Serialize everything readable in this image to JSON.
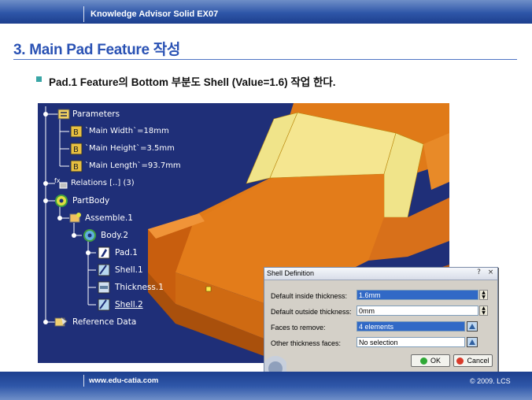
{
  "header": {
    "title": "Knowledge Advisor Solid EX07"
  },
  "slide": {
    "title": "3. Main Pad Feature 작성",
    "bullet": "Pad.1 Feature의 Bottom 부분도 Shell (Value=1.6) 작업 한다."
  },
  "tree": {
    "parameters": "Parameters",
    "param_width": "`Main Width`=18mm",
    "param_height": "`Main Height`=3.5mm",
    "param_length": "`Main Length`=93.7mm",
    "relations": "Relations [..] (3)",
    "partbody": "PartBody",
    "assemble": "Assemble.1",
    "body2": "Body.2",
    "pad1": "Pad.1",
    "shell1": "Shell.1",
    "thickness1": "Thickness.1",
    "shell2": "Shell.2",
    "reference": "Reference Data"
  },
  "dialog": {
    "title": "Shell Definition",
    "inside_label": "Default inside thickness:",
    "inside_value": "1.6mm",
    "outside_label": "Default outside thickness:",
    "outside_value": "0mm",
    "faces_remove_label": "Faces to remove:",
    "faces_remove_value": "4 elements",
    "other_faces_label": "Other thickness faces:",
    "other_faces_value": "No selection",
    "ok_label": "OK",
    "cancel_label": "Cancel",
    "title_buttons": {
      "help": "?",
      "close": "×"
    }
  },
  "footer": {
    "url": "www.edu-catia.com",
    "copyright": "© 2009. LCS"
  },
  "colors": {
    "viewport_bg": "#1f2f78",
    "part_orange": "#d46e10",
    "face_yellow": "#f0e48a",
    "accent_blue": "#2a52b4"
  }
}
